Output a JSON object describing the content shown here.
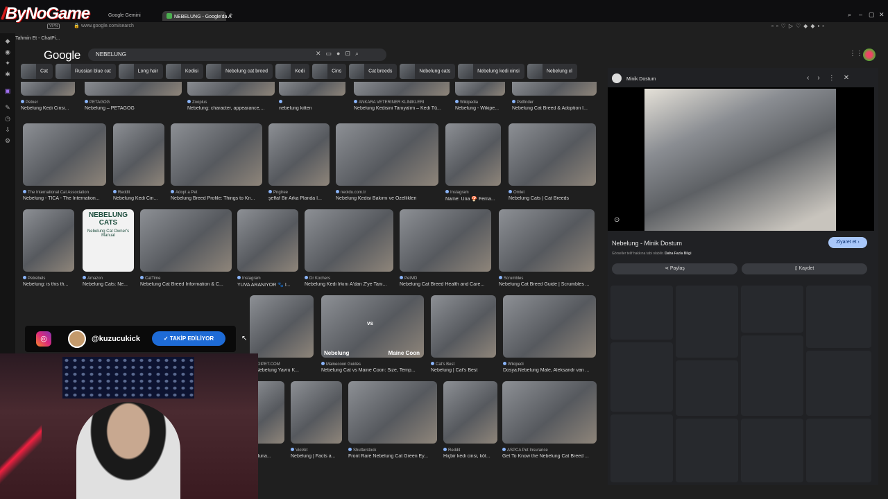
{
  "streamer_logo": "ByNoGame",
  "browser": {
    "tabs": [
      {
        "label": "Google Gemini"
      },
      {
        "label": "NEBELUNG - Google'da A"
      }
    ],
    "vpn_badge": "VPN",
    "url": "www.google.com/search",
    "bookmark": "Tahmin Et - ChatPi..."
  },
  "google": {
    "logo": "Google",
    "query": "NEBELUNG"
  },
  "chips": [
    "Cat",
    "Russian blue cat",
    "Long hair",
    "Kedisi",
    "Nebelung cat breed",
    "Kedi",
    "Cins",
    "Cat breeds",
    "Nebelung cats",
    "Nebelung kedi cinsi",
    "Nebelung cl"
  ],
  "results": [
    {
      "src": "Petner",
      "title": "Nebelung Kedi Cinsi..."
    },
    {
      "src": "PETAGOG",
      "title": "Nebelung – PETAGOG"
    },
    {
      "src": "Zooplus",
      "title": "Nebelung: character, appearance,..."
    },
    {
      "src": "",
      "title": "nebelung kitten"
    },
    {
      "src": "ANKARA VETERİNER KLİNİKLERİ",
      "title": "Nebelung Kedisini Tanıyalım – Kedi Tü..."
    },
    {
      "src": "Wikipedia",
      "title": "Nebelung - Wikipe..."
    },
    {
      "src": "Petfinder",
      "title": "Nebelung Cat Breed & Adoption I..."
    },
    {
      "src": "The International Cat Association",
      "title": "Nebelung - TICA - The Internation..."
    },
    {
      "src": "Reddit",
      "title": "Nebelung Kedi Cin..."
    },
    {
      "src": "Adopt a Pet",
      "title": "Nebelung Breed Profile: Things to Kn..."
    },
    {
      "src": "Pngtree",
      "title": "şeffaf Bir Arka Planda I..."
    },
    {
      "src": "neoldu.com.tr",
      "title": "Nebelung Kedisi Bakımı ve Özellikleri"
    },
    {
      "src": "Instagram",
      "title": "Name: Una 🍄 Fema..."
    },
    {
      "src": "Omlet",
      "title": "Nebelung Cats | Cat Breeds"
    },
    {
      "src": "Petrebels",
      "title": "Nebelung: is this th..."
    },
    {
      "src": "Amazon",
      "title": "Nebelung Cats: Ne..."
    },
    {
      "src": "CatTime",
      "title": "Nebelung Cat Breed Information & C..."
    },
    {
      "src": "Instagram",
      "title": "YUVA ARANIYOR 🐾 I..."
    },
    {
      "src": "Dr Kochers",
      "title": "Nebelung Kedi Irkını A'dan Z'ye Tanı..."
    },
    {
      "src": "PetMD",
      "title": "Nebelung Cat Breed Health and Care..."
    },
    {
      "src": "Scrumbles",
      "title": "Nebelung Cat Breed Guide | Scrumbles ..."
    },
    {
      "src": "EDIPET.COM",
      "title": "lık Nebelung Yavru K..."
    },
    {
      "src": "Mainecoon Guides",
      "title": "Nebelung Cat vs Maine Coon: Size, Temp..."
    },
    {
      "src": "Cat's Best",
      "title": "Nebelung | Cat's Best"
    },
    {
      "src": "Wikipedi",
      "title": "Dosya:Nebelung Male, Aleksandr van ..."
    },
    {
      "src": "",
      "title": "ı bulunа..."
    },
    {
      "src": "VioVet",
      "title": "Nebelung | Facts a..."
    },
    {
      "src": "Shutterstock",
      "title": "Front Rare Nebelung Cat Green Ey..."
    },
    {
      "src": "Reddit",
      "title": "Hiçbir kedi cinsi, köt..."
    },
    {
      "src": "ASPCA Pet Insurance",
      "title": "Get To Know the Nebelung Cat Breed ..."
    }
  ],
  "image_texts": {
    "book_title": "NEBELUNG CATS",
    "book_sub": "Nebelung Cat Owner's Manual",
    "vs_left": "Nebelung",
    "vs_mid": "vs",
    "vs_right": "Maine Coon"
  },
  "panel": {
    "source": "Minik Dostum",
    "title": "Nebelung - Minik Dostum",
    "visit": "Ziyaret et",
    "note": "Görseller telif hakkına tabi olabilir.",
    "note_link": "Daha Fazla Bilgi",
    "share": "Paylaş",
    "save": "Kaydet"
  },
  "overlay": {
    "handle": "@kuzucukick",
    "follow": "TAKİP EDİLİYOR"
  }
}
